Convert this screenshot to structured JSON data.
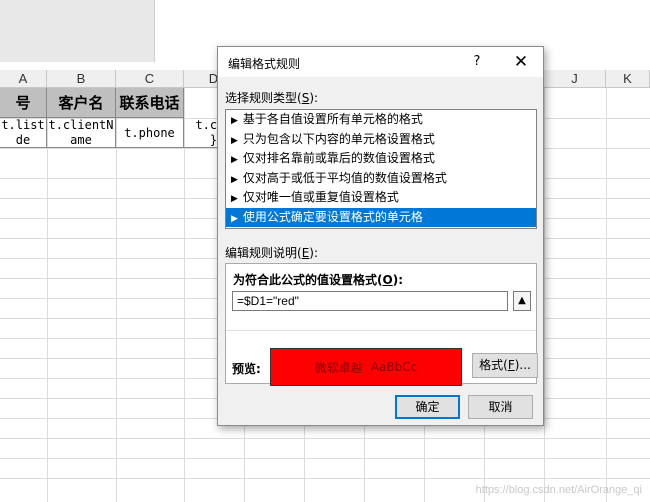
{
  "sheet": {
    "columns": [
      "A",
      "B",
      "C",
      "D",
      "J",
      "K"
    ],
    "headers": [
      "号",
      "客户名",
      "联系电话"
    ],
    "row1": [
      "t.list\nde",
      "t.clientN\name",
      "t.phone",
      "t.col\n}"
    ]
  },
  "dialog": {
    "title": "编辑格式规则",
    "help": "?",
    "close": "✕",
    "rule_type_label": "选择规则类型(",
    "rule_type_key": "S",
    "rule_type_tail": "):",
    "rules": [
      "基于各自值设置所有单元格的格式",
      "只为包含以下内容的单元格设置格式",
      "仅对排名靠前或靠后的数值设置格式",
      "仅对高于或低于平均值的数值设置格式",
      "仅对唯一值或重复值设置格式",
      "使用公式确定要设置格式的单元格"
    ],
    "desc_label": "编辑规则说明(",
    "desc_key": "E",
    "desc_tail": "):",
    "formula_label": "为符合此公式的值设置格式(",
    "formula_key": "O",
    "formula_tail": "):",
    "formula_value": "=$D1=\"red\"",
    "preview_label": "预览:",
    "preview_text": "微软卓越",
    "preview_sample": "AaBbCc",
    "format_button_pre": "格式(",
    "format_button_key": "F",
    "format_button_tail": ")...",
    "ok": "确定",
    "cancel": "取消",
    "preview_bg": "#ff0000",
    "selection_color": "#0078d7"
  },
  "watermark": "https://blog.csdn.net/AirOrange_qi"
}
